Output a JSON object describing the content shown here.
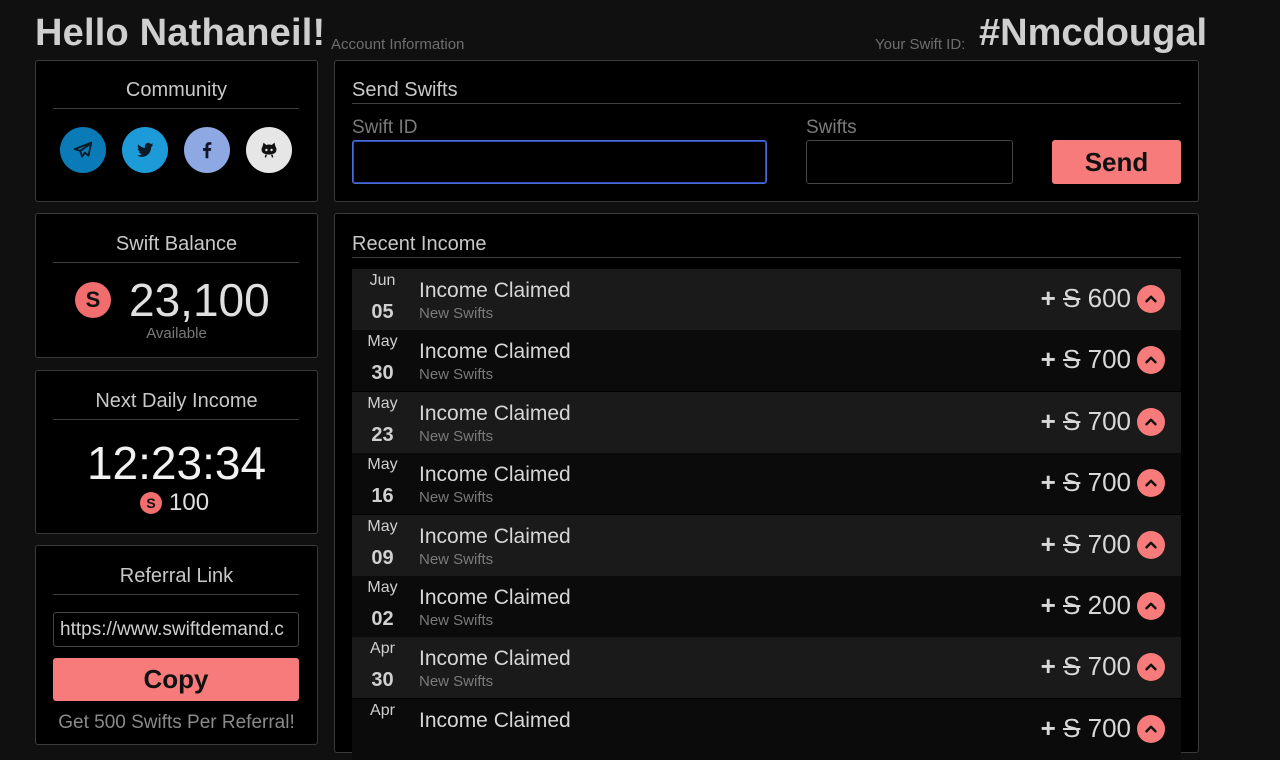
{
  "header": {
    "greeting": "Hello Nathaneil!",
    "account_link": "Account Information",
    "swift_id_label": "Your Swift ID:",
    "swift_id": "#Nmcdougal"
  },
  "community": {
    "title": "Community",
    "icons": [
      {
        "name": "telegram-icon",
        "color": "#0b7bb8"
      },
      {
        "name": "twitter-icon",
        "color": "#1d9bd8"
      },
      {
        "name": "facebook-icon",
        "color": "#8ea8e3"
      },
      {
        "name": "github-icon",
        "color": "#e6e6e6"
      }
    ]
  },
  "balance": {
    "title": "Swift Balance",
    "amount": "23,100",
    "caption": "Available"
  },
  "daily": {
    "title": "Next Daily Income",
    "timer": "12:23:34",
    "amount": "100"
  },
  "referral": {
    "title": "Referral Link",
    "link": "https://www.swiftdemand.c",
    "copy_label": "Copy",
    "note": "Get 500 Swifts Per Referral!"
  },
  "send": {
    "title": "Send Swifts",
    "swift_id_label": "Swift ID",
    "swifts_label": "Swifts",
    "swift_id_value": "",
    "swifts_value": "",
    "button_label": "Send"
  },
  "income": {
    "title": "Recent Income",
    "currency_symbol": "S",
    "rows": [
      {
        "month": "Jun",
        "day": "05",
        "title": "Income Claimed",
        "sub": "New Swifts",
        "amount": "600"
      },
      {
        "month": "May",
        "day": "30",
        "title": "Income Claimed",
        "sub": "New Swifts",
        "amount": "700"
      },
      {
        "month": "May",
        "day": "23",
        "title": "Income Claimed",
        "sub": "New Swifts",
        "amount": "700"
      },
      {
        "month": "May",
        "day": "16",
        "title": "Income Claimed",
        "sub": "New Swifts",
        "amount": "700"
      },
      {
        "month": "May",
        "day": "09",
        "title": "Income Claimed",
        "sub": "New Swifts",
        "amount": "700"
      },
      {
        "month": "May",
        "day": "02",
        "title": "Income Claimed",
        "sub": "New Swifts",
        "amount": "200"
      },
      {
        "month": "Apr",
        "day": "30",
        "title": "Income Claimed",
        "sub": "New Swifts",
        "amount": "700"
      },
      {
        "month": "Apr",
        "day": "",
        "title": "Income Claimed",
        "sub": "",
        "amount": "700"
      }
    ]
  },
  "colors": {
    "accent": "#f77b7b",
    "background": "#101010",
    "card": "#000000"
  }
}
